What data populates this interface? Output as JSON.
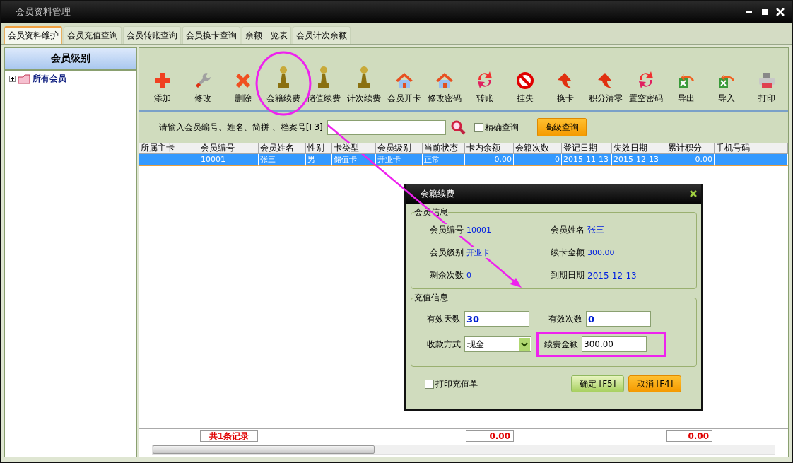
{
  "window": {
    "title": "会员资料管理"
  },
  "tabs": [
    {
      "label": "会员资料维护",
      "selected": true
    },
    {
      "label": "会员充值查询",
      "selected": false
    },
    {
      "label": "会员转账查询",
      "selected": false
    },
    {
      "label": "会员换卡查询",
      "selected": false
    },
    {
      "label": "余额一览表",
      "selected": false
    },
    {
      "label": "会员计次余额",
      "selected": false
    }
  ],
  "sidebar": {
    "title": "会员级别",
    "tree": [
      {
        "label": "所有会员",
        "expanded": false
      }
    ]
  },
  "toolbar": [
    {
      "label": "添加",
      "kind": "add",
      "highlighted": false
    },
    {
      "label": "修改",
      "kind": "edit",
      "highlighted": false
    },
    {
      "label": "删除",
      "kind": "delete",
      "highlighted": false
    },
    {
      "label": "会籍续费",
      "kind": "pawn",
      "highlighted": true
    },
    {
      "label": "储值续费",
      "kind": "pawn",
      "highlighted": false
    },
    {
      "label": "计次续费",
      "kind": "pawn",
      "highlighted": false
    },
    {
      "label": "会员开卡",
      "kind": "house",
      "highlighted": false
    },
    {
      "label": "修改密码",
      "kind": "house",
      "highlighted": false
    },
    {
      "label": "转账",
      "kind": "swap",
      "highlighted": false
    },
    {
      "label": "挂失",
      "kind": "ban",
      "highlighted": false
    },
    {
      "label": "换卡",
      "kind": "arrow",
      "highlighted": false
    },
    {
      "label": "积分清零",
      "kind": "arrow",
      "highlighted": false
    },
    {
      "label": "置空密码",
      "kind": "swap",
      "highlighted": false
    },
    {
      "label": "导出",
      "kind": "excel",
      "highlighted": false
    },
    {
      "label": "导入",
      "kind": "excel",
      "highlighted": false
    },
    {
      "label": "打印",
      "kind": "print",
      "highlighted": false
    }
  ],
  "search": {
    "label": "请输入会员编号、姓名、简拼 、档案号[F3]",
    "exact_match": {
      "label": "精确查询",
      "checked": false
    },
    "advanced_button": "高级查询"
  },
  "table": {
    "columns": [
      "所属主卡",
      "会员编号",
      "会员姓名",
      "性别",
      "卡类型",
      "会员级别",
      "当前状态",
      "卡内余额",
      "会籍次数",
      "登记日期",
      "失效日期",
      "累计积分",
      "手机号码"
    ],
    "rows": [
      {
        "selected": true,
        "cells": [
          "",
          "10001",
          "张三",
          "男",
          "储值卡",
          "开业卡",
          "正常",
          "0.00",
          "0",
          "2015-11-13",
          "2015-12-13",
          "0.00",
          ""
        ]
      }
    ]
  },
  "footer": {
    "record_count": "共1条记录",
    "totals": [
      "0.00",
      "0.00"
    ]
  },
  "dialog": {
    "title": "会籍续费",
    "member_info": {
      "legend": "会员信息",
      "fields": [
        {
          "label": "会员编号",
          "value": "10001"
        },
        {
          "label": "会员姓名",
          "value": "张三"
        },
        {
          "label": "会员级别",
          "value": "开业卡"
        },
        {
          "label": "续卡金额",
          "value": "300.00"
        },
        {
          "label": "剩余次数",
          "value": "0"
        },
        {
          "label": "到期日期",
          "value": "2015-12-13"
        }
      ]
    },
    "recharge_info": {
      "legend": "充值信息",
      "fields": [
        {
          "label": "有效天数",
          "value": "30",
          "kind": "count",
          "highlighted": false
        },
        {
          "label": "有效次数",
          "value": "0",
          "kind": "count",
          "highlighted": false
        },
        {
          "label": "收款方式",
          "value": "现金",
          "kind": "select",
          "highlighted": false
        },
        {
          "label": "续费金额",
          "value": "300.00",
          "kind": "amount",
          "highlighted": true
        }
      ]
    },
    "print_receipt": {
      "label": "打印充值单",
      "checked": false
    },
    "buttons": [
      {
        "label": "确定 [F5]",
        "kind": "confirm"
      },
      {
        "label": "取消 [F4]",
        "kind": "cancel"
      }
    ]
  }
}
